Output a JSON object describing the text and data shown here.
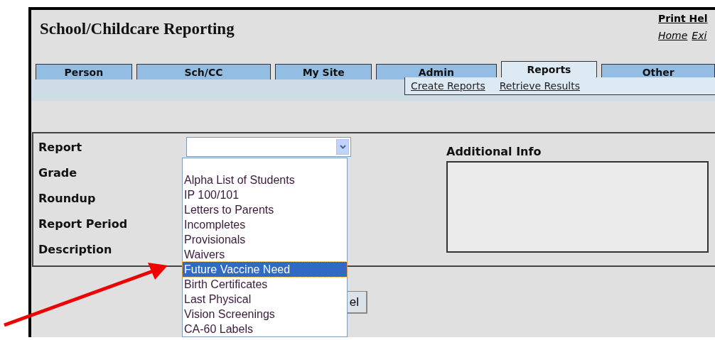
{
  "header": {
    "title": "School/Childcare Reporting",
    "top_link": "Print Hel",
    "links": [
      "Home",
      "Exi"
    ]
  },
  "tabs": [
    {
      "label": "Person",
      "selected": false
    },
    {
      "label": "Sch/CC",
      "selected": false
    },
    {
      "label": "My Site",
      "selected": false
    },
    {
      "label": "Admin",
      "selected": false
    },
    {
      "label": "Reports",
      "selected": true
    },
    {
      "label": "Other",
      "selected": false
    }
  ],
  "subnav": [
    "Create Reports",
    "Retrieve Results"
  ],
  "form": {
    "labels": [
      "Report",
      "Grade",
      "Roundup",
      "Report Period",
      "Description"
    ],
    "additional_info": {
      "label": "Additional Info"
    },
    "report_dropdown": {
      "expanded": true,
      "options": [
        {
          "label": "Alpha List of Students",
          "selected": false
        },
        {
          "label": "IP 100/101",
          "selected": false
        },
        {
          "label": "Letters to Parents",
          "selected": false
        },
        {
          "label": "Incompletes",
          "selected": false
        },
        {
          "label": "Provisionals",
          "selected": false
        },
        {
          "label": "Waivers",
          "selected": false
        },
        {
          "label": "Future Vaccine Need",
          "selected": true
        },
        {
          "label": "Birth Certificates",
          "selected": false
        },
        {
          "label": "Last Physical",
          "selected": false
        },
        {
          "label": "Vision Screenings",
          "selected": false
        },
        {
          "label": "CA-60 Labels",
          "selected": false
        }
      ]
    }
  },
  "button_partial": "el"
}
